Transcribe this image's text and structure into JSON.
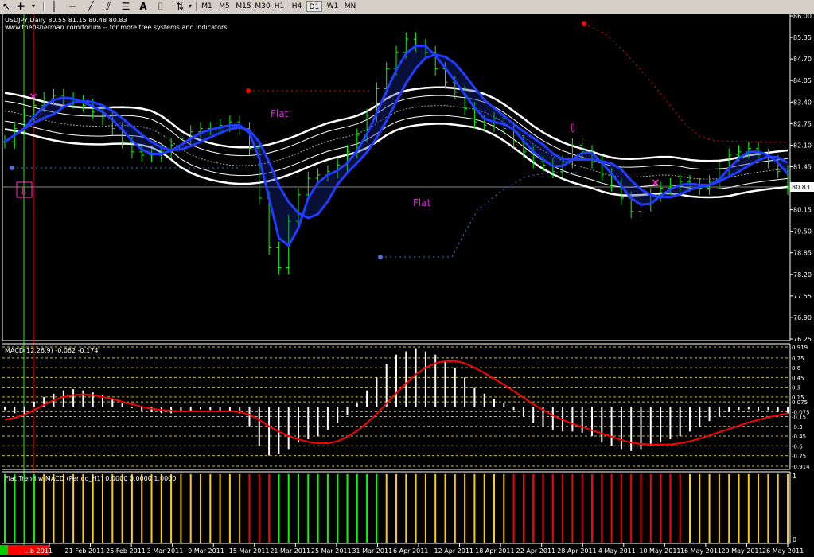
{
  "toolbar": {
    "timeframes": [
      "M1",
      "M5",
      "M15",
      "M30",
      "H1",
      "H4",
      "D1",
      "W1",
      "MN"
    ],
    "active_timeframe": "D1",
    "icons": [
      "cursor-icon",
      "crosshair-icon",
      "horizontal-line-icon",
      "vertical-line-icon",
      "trendline-icon",
      "channel-icon",
      "text-label-icon",
      "arrow-label-icon"
    ]
  },
  "colors": {
    "background": "#000000",
    "bull_candle": "#00ff00",
    "ma_band": "#1f3cff",
    "envelope": "#ffffff",
    "macd_signal": "#ff0000",
    "macd_hist": "#ffffff",
    "flat_label": "#cc33cc",
    "trend_up": "#00ff00",
    "trend_down": "#ff0000",
    "trend_flat": "#ffcc00",
    "gridline": "#d4c000"
  },
  "chart_data": [
    {
      "type": "candlestick",
      "title": "USDJPY,Daily  80.55 81.15 80.48 80.83",
      "subtitle": "www.thefisherman.com/forum -- for more free systems and indicators.",
      "ylim": [
        76.25,
        86.0
      ],
      "y_ticks": [
        "86.00",
        "85.35",
        "84.70",
        "84.05",
        "83.40",
        "82.75",
        "82.10",
        "81.45",
        "80.83",
        "80.15",
        "79.50",
        "78.85",
        "78.20",
        "77.55",
        "76.90",
        "76.25"
      ],
      "current_price": 80.83,
      "x_ticks": [
        "…b 2011",
        "21 Feb 2011",
        "25 Feb 2011",
        "3 Mar 2011",
        "9 Mar 2011",
        "15 Mar 2011",
        "21 Mar 2011",
        "25 Mar 2011",
        "31 Mar 2011",
        "6 Apr 2011",
        "12 Apr 2011",
        "18 Apr 2011",
        "22 Apr 2011",
        "28 Apr 2011",
        "4 May 2011",
        "10 May 2011",
        "16 May 2011",
        "20 May 2011",
        "26 May 2011"
      ],
      "labels": [
        "Flat",
        "Flat"
      ],
      "closes": [
        82.2,
        82.6,
        83.0,
        83.3,
        83.5,
        83.6,
        83.5,
        83.4,
        83.3,
        83.1,
        82.9,
        82.6,
        82.2,
        81.9,
        81.8,
        81.8,
        81.9,
        82.1,
        82.3,
        82.5,
        82.6,
        82.6,
        82.7,
        82.8,
        82.6,
        82.0,
        80.5,
        79.0,
        78.4,
        79.8,
        80.6,
        81.1,
        81.2,
        81.3,
        81.5,
        81.9,
        82.4,
        83.0,
        83.8,
        84.4,
        84.9,
        85.3,
        85.1,
        84.9,
        84.4,
        84.0,
        83.7,
        83.2,
        82.8,
        82.7,
        82.9,
        82.6,
        82.2,
        81.9,
        81.6,
        81.5,
        81.3,
        81.6,
        82.1,
        81.9,
        81.6,
        81.2,
        80.9,
        80.5,
        80.1,
        80.3,
        80.6,
        80.8,
        80.9,
        81.0,
        80.9,
        80.8,
        81.0,
        81.4,
        81.8,
        81.9,
        82.0,
        81.8,
        81.6,
        81.3,
        80.8
      ]
    },
    {
      "type": "bar",
      "title": "MACD(12,26,9) -0.062 -0.174",
      "ylim": [
        -0.914,
        0.919
      ],
      "y_ticks": [
        "0.919",
        "0.75",
        "0.6",
        "0.45",
        "0.3",
        "0.15",
        "0.075",
        "-0.075",
        "-0.15",
        "-0.3",
        "-0.45",
        "-0.6",
        "-0.75",
        "-0.914"
      ],
      "histogram": [
        -0.05,
        -0.1,
        -0.12,
        0.08,
        0.15,
        0.2,
        0.25,
        0.27,
        0.25,
        0.22,
        0.18,
        0.12,
        0.05,
        -0.02,
        -0.06,
        -0.08,
        -0.1,
        -0.1,
        -0.08,
        -0.06,
        -0.04,
        -0.05,
        -0.06,
        -0.06,
        -0.1,
        -0.3,
        -0.6,
        -0.75,
        -0.72,
        -0.65,
        -0.55,
        -0.5,
        -0.45,
        -0.35,
        -0.25,
        -0.12,
        0.05,
        0.25,
        0.45,
        0.65,
        0.8,
        0.85,
        0.9,
        0.85,
        0.8,
        0.7,
        0.6,
        0.45,
        0.3,
        0.2,
        0.12,
        0.05,
        -0.05,
        -0.15,
        -0.25,
        -0.3,
        -0.35,
        -0.38,
        -0.38,
        -0.4,
        -0.45,
        -0.55,
        -0.6,
        -0.65,
        -0.68,
        -0.65,
        -0.6,
        -0.55,
        -0.5,
        -0.45,
        -0.38,
        -0.3,
        -0.22,
        -0.15,
        -0.08,
        -0.05,
        -0.04,
        -0.06,
        -0.05,
        -0.08,
        -0.1
      ],
      "signal": [
        -0.2,
        -0.17,
        -0.12,
        -0.05,
        0.03,
        0.1,
        0.15,
        0.18,
        0.19,
        0.18,
        0.15,
        0.12,
        0.08,
        0.04,
        0.0,
        -0.03,
        -0.05,
        -0.06,
        -0.07,
        -0.07,
        -0.07,
        -0.07,
        -0.07,
        -0.07,
        -0.08,
        -0.12,
        -0.2,
        -0.3,
        -0.38,
        -0.45,
        -0.5,
        -0.54,
        -0.56,
        -0.56,
        -0.53,
        -0.46,
        -0.37,
        -0.25,
        -0.11,
        0.05,
        0.21,
        0.36,
        0.5,
        0.6,
        0.67,
        0.7,
        0.7,
        0.67,
        0.6,
        0.52,
        0.43,
        0.34,
        0.24,
        0.14,
        0.04,
        -0.05,
        -0.13,
        -0.2,
        -0.26,
        -0.31,
        -0.36,
        -0.41,
        -0.46,
        -0.51,
        -0.55,
        -0.57,
        -0.58,
        -0.58,
        -0.58,
        -0.56,
        -0.53,
        -0.49,
        -0.44,
        -0.39,
        -0.34,
        -0.29,
        -0.24,
        -0.2,
        -0.16,
        -0.13,
        -0.1
      ]
    },
    {
      "type": "bar",
      "title": "Flat Trend w MACD (Period_H1) 0.0000 0.0000 1.0000",
      "y_ticks": [
        "1",
        "0"
      ],
      "states": [
        "up",
        "up",
        "up",
        "up",
        "flat",
        "flat",
        "flat",
        "flat",
        "flat",
        "flat",
        "flat",
        "flat",
        "flat",
        "flat",
        "flat",
        "flat",
        "flat",
        "flat",
        "flat",
        "flat",
        "flat",
        "flat",
        "flat",
        "flat",
        "flat",
        "down",
        "down",
        "down",
        "up",
        "up",
        "up",
        "up",
        "up",
        "up",
        "up",
        "up",
        "up",
        "up",
        "up",
        "flat",
        "flat",
        "flat",
        "flat",
        "flat",
        "flat",
        "flat",
        "flat",
        "flat",
        "flat",
        "flat",
        "flat",
        "flat",
        "down",
        "down",
        "down",
        "down",
        "down",
        "down",
        "down",
        "down",
        "down",
        "down",
        "down",
        "down",
        "down",
        "down",
        "down",
        "down",
        "down",
        "down",
        "flat",
        "flat",
        "flat",
        "flat",
        "flat",
        "flat",
        "flat",
        "flat",
        "flat",
        "flat",
        "flat"
      ]
    }
  ]
}
